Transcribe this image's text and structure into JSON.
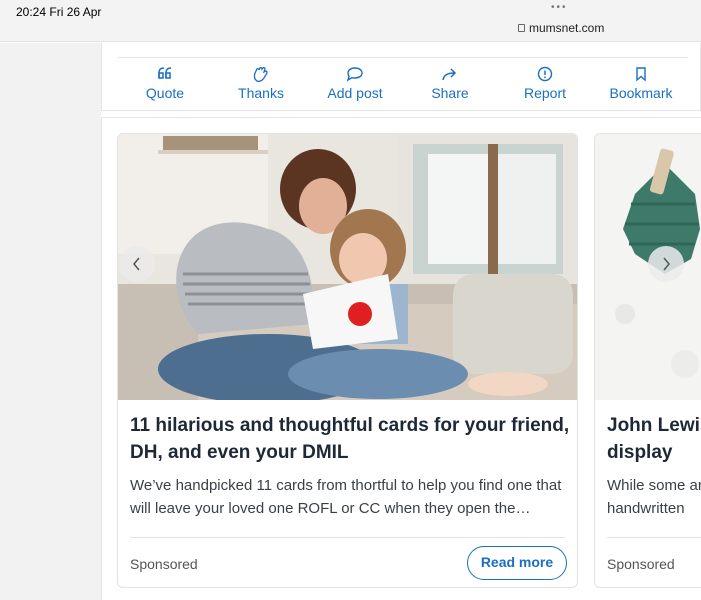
{
  "status_bar": {
    "time": "20:24  Fri 26 Apr",
    "dots": "•••",
    "url": "mumsnet.com"
  },
  "actions": [
    {
      "label": "Quote",
      "icon": "quote-icon"
    },
    {
      "label": "Thanks",
      "icon": "clap-icon"
    },
    {
      "label": "Add post",
      "icon": "speech-bubble-icon"
    },
    {
      "label": "Share",
      "icon": "share-arrow-icon"
    },
    {
      "label": "Report",
      "icon": "alert-circle-icon"
    },
    {
      "label": "Bookmark",
      "icon": "bookmark-icon"
    }
  ],
  "carousel": {
    "prev_icon": "chevron-left-icon",
    "next_icon": "chevron-right-icon",
    "cards": [
      {
        "title": "11 hilarious and thoughtful cards for your friend, DH, and even your DMIL",
        "description": "We’ve handpicked 11 cards from thortful to help you find one that will leave your loved one ROFL or CC when they open the…",
        "sponsored": "Sponsored",
        "cta": "Read more"
      },
      {
        "title": "John Lewis and display",
        "description": "While some ar a handwritten",
        "sponsored": "Sponsored"
      }
    ]
  },
  "colors": {
    "accent": "#1a6fc4",
    "title": "#1e2836",
    "sidebar": "#f2f2f2"
  }
}
